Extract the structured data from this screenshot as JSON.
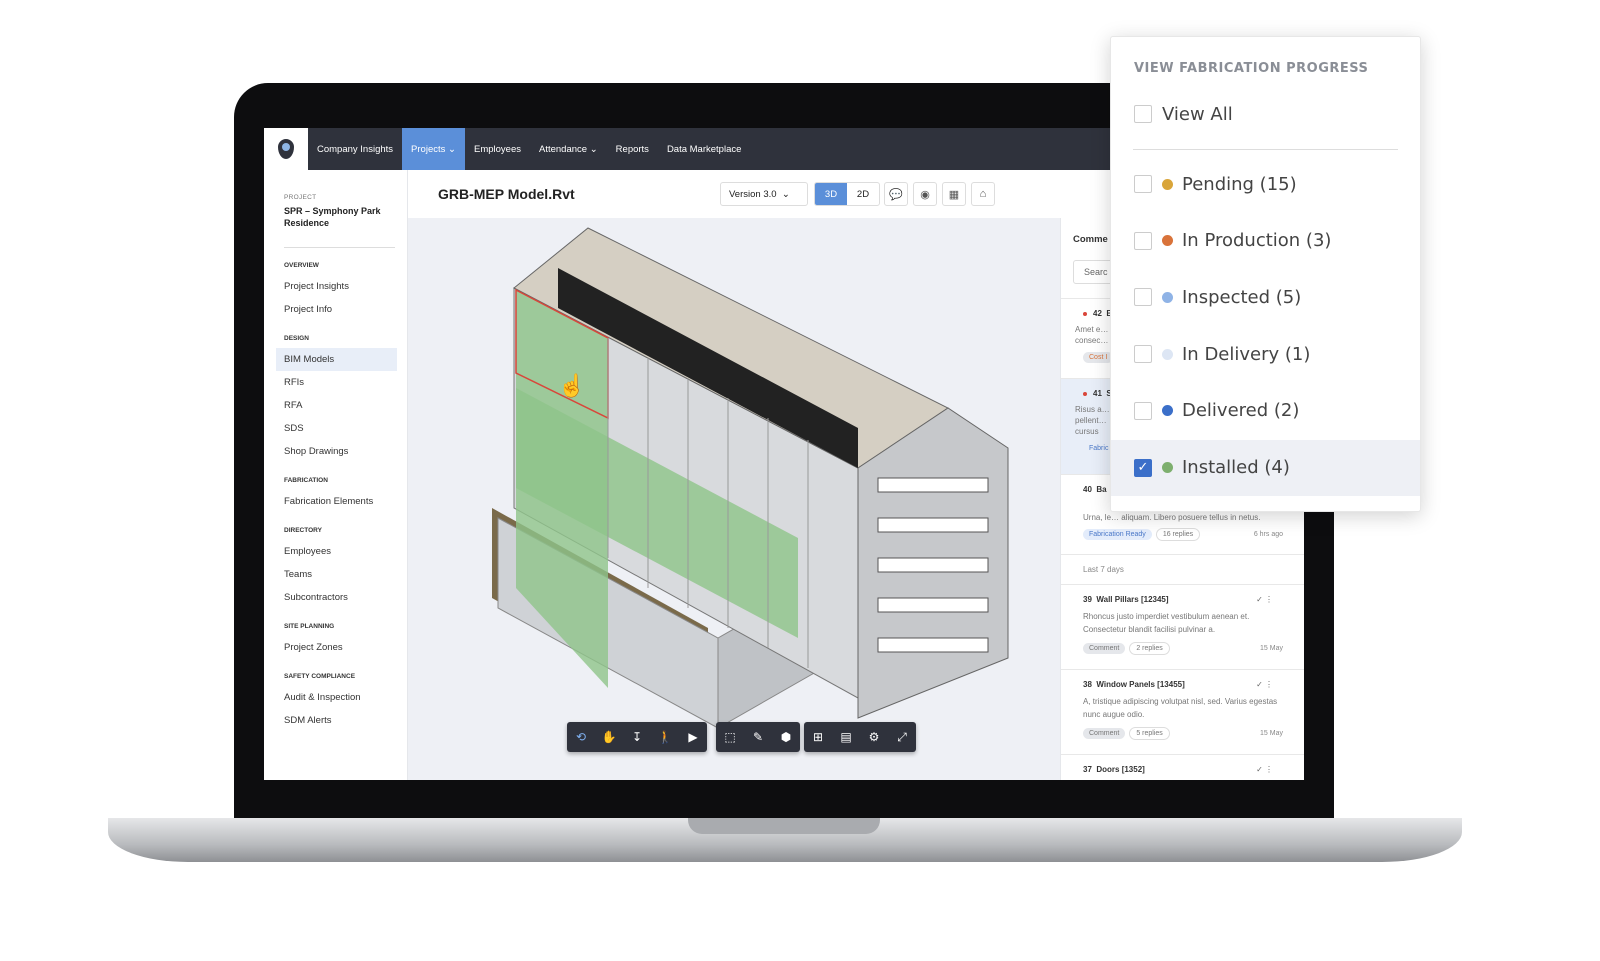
{
  "nav": {
    "items": [
      "Company Insights",
      "Projects",
      "Employees",
      "Attendance",
      "Reports",
      "Data Marketplace"
    ],
    "active": "Projects"
  },
  "sidebar": {
    "project_label": "PROJECT",
    "project_name": "SPR – Symphony Park Residence",
    "sections": [
      {
        "title": "OVERVIEW",
        "items": [
          "Project Insights",
          "Project Info"
        ]
      },
      {
        "title": "DESIGN",
        "items": [
          "BIM Models",
          "RFIs",
          "RFA",
          "SDS",
          "Shop Drawings"
        ]
      },
      {
        "title": "FABRICATION",
        "items": [
          "Fabrication Elements"
        ]
      },
      {
        "title": "DIRECTORY",
        "items": [
          "Employees",
          "Teams",
          "Subcontractors"
        ]
      },
      {
        "title": "SITE PLANNING",
        "items": [
          "Project Zones"
        ]
      },
      {
        "title": "SAFETY COMPLIANCE",
        "items": [
          "Audit & Inspection",
          "SDM Alerts"
        ]
      }
    ],
    "selected": "BIM Models"
  },
  "header": {
    "title": "GRB-MEP Model.Rvt",
    "version": "Version 3.0",
    "mode_3d": "3D",
    "mode_2d": "2D"
  },
  "comments": {
    "title": "Comme",
    "search_placeholder": "Searc",
    "last7": "Last 7 days",
    "items": [
      {
        "num": "42",
        "title": "Ba",
        "body": "Amet e… consec…",
        "tag": "Cost I"
      },
      {
        "num": "41",
        "title": "Sla",
        "body": "Risus a… pellent… cursus",
        "tag": "Fabric"
      },
      {
        "num": "40",
        "title": "Ba",
        "body": "Urna, le… aliquam. Libero posuere tellus in netus.",
        "tag": "Fabrication Ready",
        "replies": "16 replies",
        "date": "6 hrs ago"
      },
      {
        "num": "39",
        "title": "Wall Pillars [12345]",
        "body": "Rhoncus justo imperdiet vestibulum aenean et. Consectetur blandit facilisi pulvinar a.",
        "tag": "Comment",
        "replies": "2 replies",
        "date": "15 May"
      },
      {
        "num": "38",
        "title": "Window Panels [13455]",
        "body": "A, tristique adipiscing volutpat nisl, sed. Varius egestas nunc augue odio.",
        "tag": "Comment",
        "replies": "5 replies",
        "date": "15 May"
      },
      {
        "num": "37",
        "title": "Doors [1352]"
      }
    ]
  },
  "fabrication": {
    "title": "VIEW FABRICATION PROGRESS",
    "view_all": "View All",
    "statuses": [
      {
        "label": "Pending (15)",
        "color": "#d9a53a",
        "checked": false
      },
      {
        "label": "In Production (3)",
        "color": "#d9733a",
        "checked": false
      },
      {
        "label": "Inspected (5)",
        "color": "#8fb3e6",
        "checked": false
      },
      {
        "label": "In Delivery (1)",
        "color": "#dde6f4",
        "checked": false
      },
      {
        "label": "Delivered (2)",
        "color": "#3b6fc9",
        "checked": false
      },
      {
        "label": "Installed (4)",
        "color": "#7daf6e",
        "checked": true
      }
    ]
  },
  "colors": {
    "nav": "#2f323c",
    "accent": "#5b8fd9",
    "installed": "#7daf6e"
  }
}
